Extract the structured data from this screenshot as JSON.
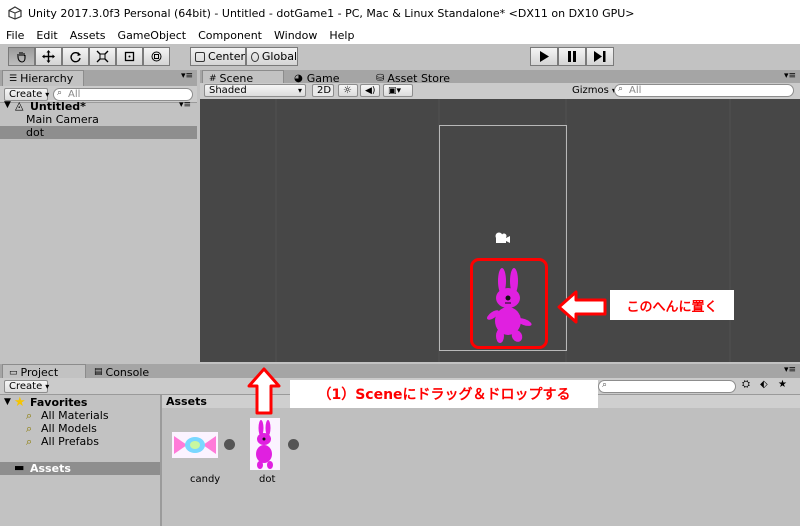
{
  "window": {
    "title": "Unity 2017.3.0f3 Personal (64bit) - Untitled - dotGame1 - PC, Mac & Linux Standalone* <DX11 on DX10 GPU>"
  },
  "menu": [
    "File",
    "Edit",
    "Assets",
    "GameObject",
    "Component",
    "Window",
    "Help"
  ],
  "toolbar": {
    "center_label": "Center",
    "global_label": "Global"
  },
  "hierarchy": {
    "tab": "Hierarchy",
    "create": "Create",
    "search_placeholder": "All",
    "scene_name": "Untitled*",
    "items": [
      "Main Camera",
      "dot"
    ]
  },
  "scene_tabs": [
    "Scene",
    "Game",
    "Asset Store"
  ],
  "scene_bar": {
    "shading": "Shaded",
    "mode_2d": "2D",
    "gizmos": "Gizmos",
    "search_placeholder": "All"
  },
  "project": {
    "tabs": [
      "Project",
      "Console"
    ],
    "create": "Create",
    "favorites_label": "Favorites",
    "favorites": [
      "All Materials",
      "All Models",
      "All Prefabs"
    ],
    "assets_folder": "Assets",
    "assets_header": "Assets",
    "assets": [
      {
        "name": "candy",
        "icon": "candy-sprite-icon"
      },
      {
        "name": "dot",
        "icon": "rabbit-sprite-icon"
      }
    ]
  },
  "annotations": {
    "place_here": "このへんに置く",
    "drag_instruction": "（1）Sceneにドラッグ＆ドロップする"
  },
  "colors": {
    "annotation_red": "#ff0000",
    "rabbit_pink": "#e020e0",
    "scene_bg": "#474747"
  }
}
